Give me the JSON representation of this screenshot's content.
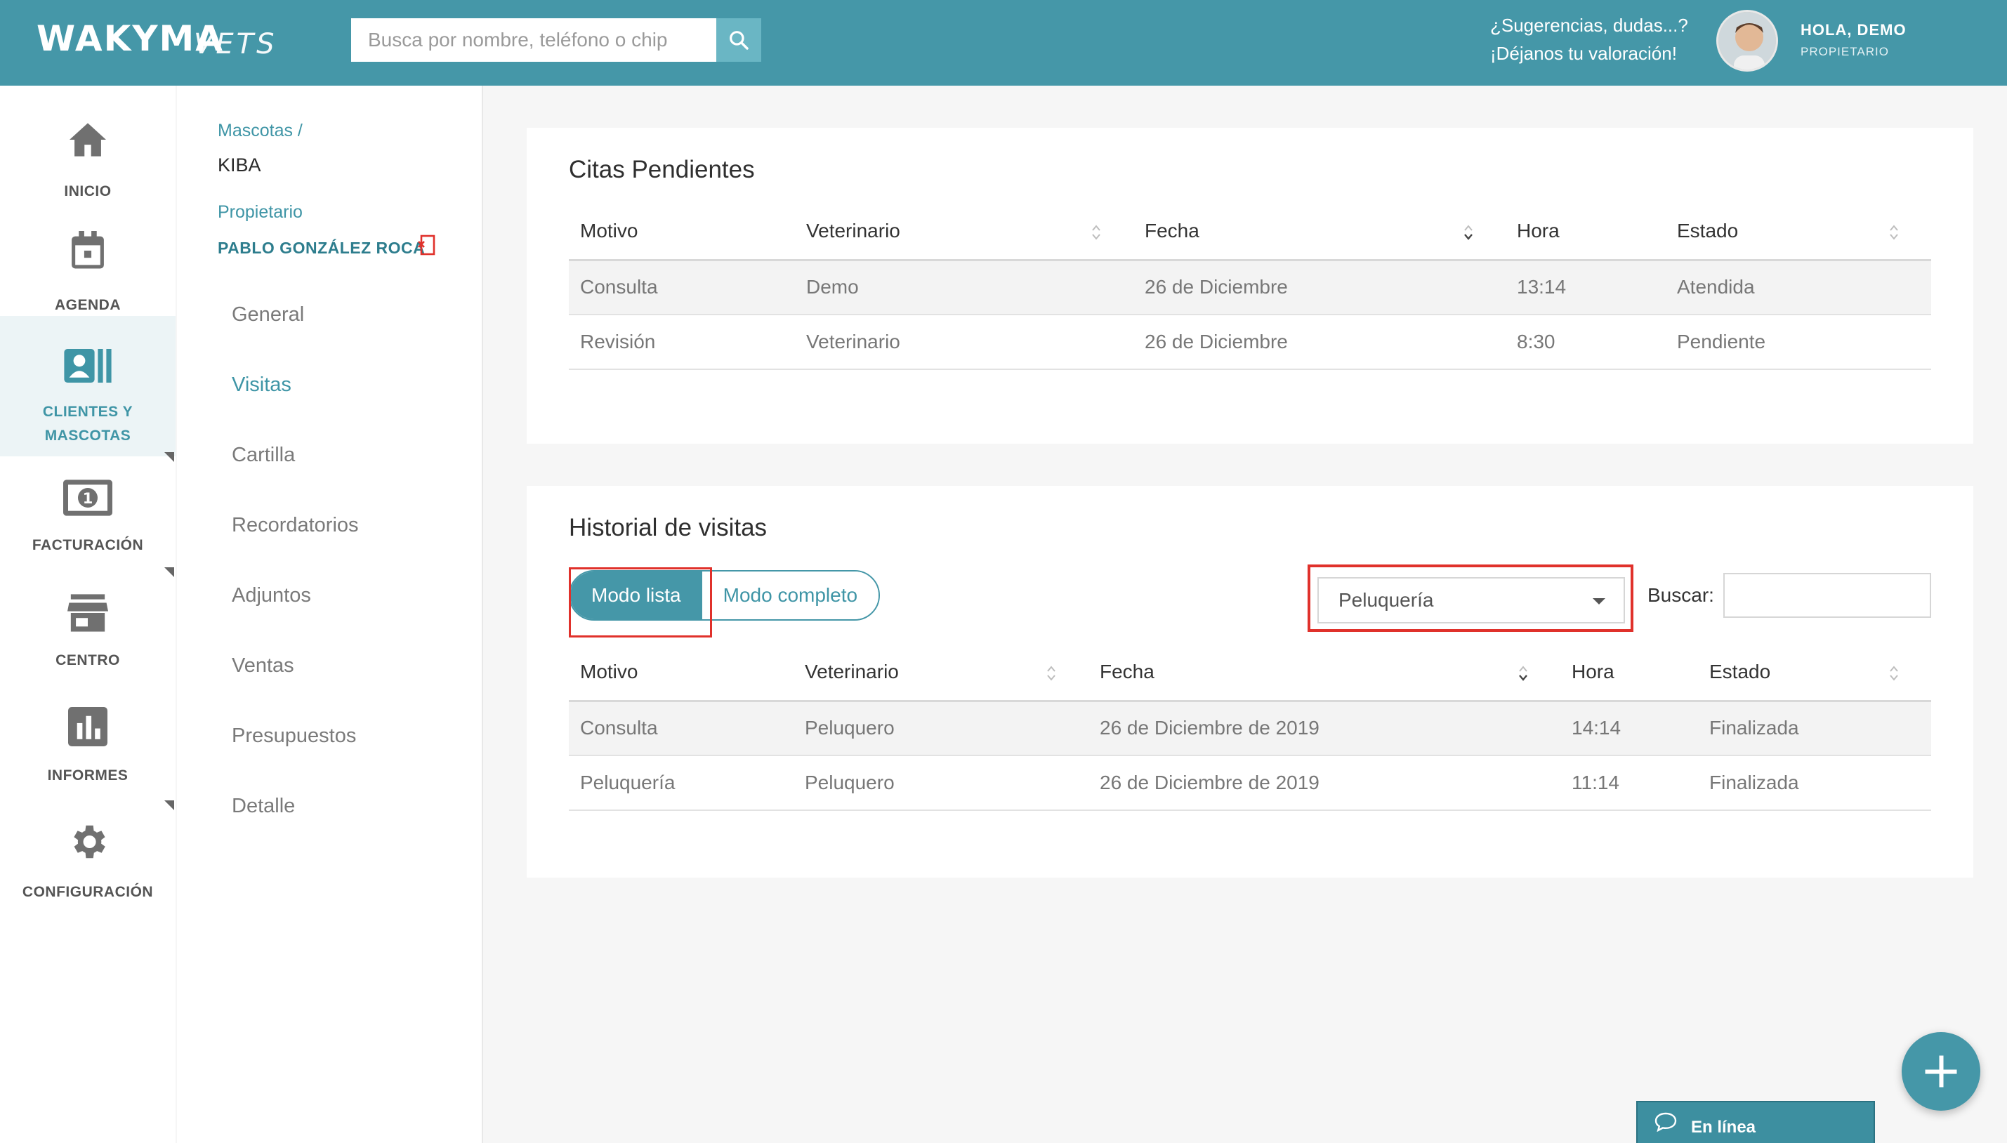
{
  "header": {
    "logo": "WAKYMA",
    "logo_sub": "VETS",
    "search_placeholder": "Busca por nombre, teléfono o chip",
    "feedback_line1": "¿Sugerencias, dudas...?",
    "feedback_line2": "¡Déjanos tu valoración!",
    "greeting": "HOLA, DEMO",
    "role": "PROPIETARIO"
  },
  "leftnav": {
    "items": [
      {
        "label": "INICIO",
        "icon": "home-icon"
      },
      {
        "label": "AGENDA",
        "icon": "calendar-icon"
      },
      {
        "label_line1": "CLIENTES Y",
        "label_line2": "MASCOTAS",
        "icon": "contacts-icon",
        "active": true
      },
      {
        "label": "FACTURACIÓN",
        "icon": "money-icon"
      },
      {
        "label": "CENTRO",
        "icon": "store-icon"
      },
      {
        "label": "INFORMES",
        "icon": "chart-icon"
      },
      {
        "label": "CONFIGURACIÓN",
        "icon": "gear-icon"
      }
    ]
  },
  "subnav": {
    "breadcrumb": "Mascotas /",
    "pet_name": "KIBA",
    "owner_label": "Propietario",
    "owner_name": "PABLO GONZÁLEZ ROCA",
    "menu": [
      "General",
      "Visitas",
      "Cartilla",
      "Recordatorios",
      "Adjuntos",
      "Ventas",
      "Presupuestos",
      "Detalle"
    ],
    "active_menu": "Visitas"
  },
  "pending": {
    "title": "Citas Pendientes",
    "columns": [
      "Motivo",
      "Veterinario",
      "Fecha",
      "Hora",
      "Estado"
    ],
    "rows": [
      [
        "Consulta",
        "Demo",
        "26 de Diciembre",
        "13:14",
        "Atendida"
      ],
      [
        "Revisión",
        "Veterinario",
        "26 de Diciembre",
        "8:30",
        "Pendiente"
      ]
    ]
  },
  "history": {
    "title": "Historial de visitas",
    "mode_list": "Modo lista",
    "mode_full": "Modo completo",
    "filter_value": "Peluquería",
    "search_label": "Buscar:",
    "columns": [
      "Motivo",
      "Veterinario",
      "Fecha",
      "Hora",
      "Estado"
    ],
    "rows": [
      [
        "Consulta",
        "Peluquero",
        "26 de Diciembre de 2019",
        "14:14",
        "Finalizada"
      ],
      [
        "Peluquería",
        "Peluquero",
        "26 de Diciembre de 2019",
        "11:14",
        "Finalizada"
      ]
    ]
  },
  "chat": {
    "label": "En línea"
  },
  "colors": {
    "brand": "#4597a8",
    "highlight": "#e0312b"
  }
}
